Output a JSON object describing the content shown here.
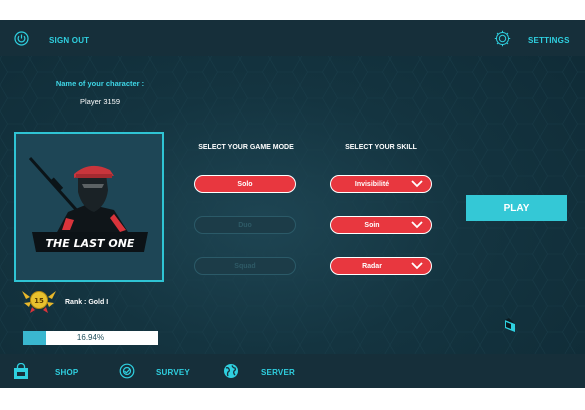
{
  "topbar": {
    "sign_out_label": "SIGN OUT",
    "settings_label": "SETTINGS"
  },
  "character": {
    "name_label": "Name of your character :",
    "name_value": "Player 3159",
    "portrait_title": "THE LAST ONE"
  },
  "game_mode": {
    "heading": "SELECT YOUR GAME MODE",
    "options": [
      {
        "label": "Solo",
        "selected": true
      },
      {
        "label": "Duo",
        "selected": false
      },
      {
        "label": "Squad",
        "selected": false
      }
    ]
  },
  "skills": {
    "heading": "SELECT YOUR SKILL",
    "slots": [
      "Invisibilité",
      "Soin",
      "Radar"
    ]
  },
  "play_label": "PLAY",
  "rank": {
    "badge_number": "15",
    "label": "Rank : Gold I"
  },
  "progress": {
    "percent": 16.94,
    "text": "16.94%"
  },
  "bottombar": {
    "shop_label": "SHOP",
    "survey_label": "SURVEY",
    "server_label": "SERVER"
  },
  "colors": {
    "accent": "#2fd0e0",
    "danger": "#e8373f",
    "background": "#143440",
    "bar": "#162f3a"
  },
  "icons": [
    "power-icon",
    "gear-icon",
    "shopping-bag-icon",
    "survey-icon",
    "globe-icon",
    "ranked-badge-icon",
    "chevron-down-icon"
  ]
}
